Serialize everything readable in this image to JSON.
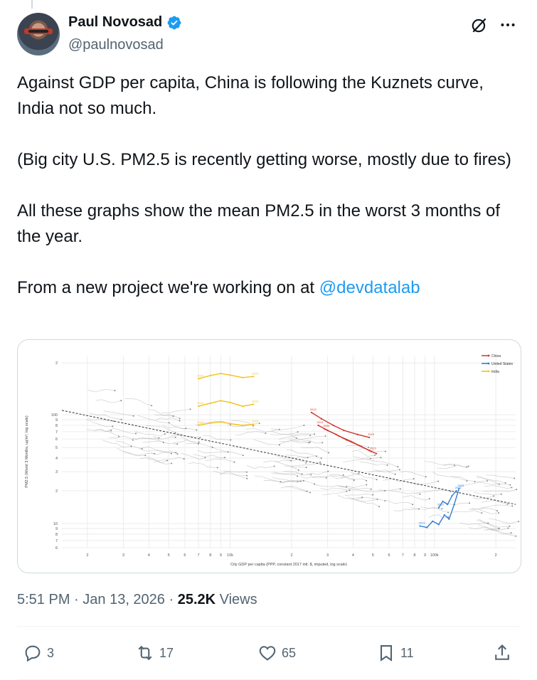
{
  "author": {
    "name": "Paul Novosad",
    "handle": "@paulnovosad"
  },
  "tweet": {
    "para1": "Against GDP per capita, China is following the Kuznets curve, India not so much.",
    "para2": "(Big city U.S. PM2.5 is recently getting worse, mostly due to fires)",
    "para3": "All these graphs show the mean PM2.5 in the worst 3 months of the year.",
    "para4_prefix": "From a new project we're working on at ",
    "mention": "@devdatalab"
  },
  "meta": {
    "time": "5:51 PM",
    "sep": " · ",
    "date": "Jan 13, 2026",
    "views_count": "25.2K",
    "views_label": " Views"
  },
  "actions": {
    "replies": "3",
    "reposts": "17",
    "likes": "65",
    "bookmarks": "11"
  },
  "chart_data": {
    "type": "line",
    "title": "",
    "xlabel": "City GDP per capita (PPP, constant 2017 intl. $, imputed, log scale)",
    "ylabel": "PM2.5 (Worst 3 Months, ug/m³, log scale)",
    "x_scale": "log",
    "y_scale": "log",
    "xlim": [
      1500,
      250000
    ],
    "ylim": [
      6,
      350
    ],
    "x_tick_labels": [
      "2",
      "3",
      "4",
      "5",
      "6",
      "7",
      "8",
      "9",
      "10k",
      "2",
      "3",
      "4",
      "5",
      "6",
      "7",
      "8",
      "9",
      "100k",
      "2"
    ],
    "y_tick_labels": [
      "2",
      "100",
      "9",
      "8",
      "7",
      "6",
      "5",
      "4",
      "3",
      "2",
      "10",
      "9",
      "8",
      "7",
      "6"
    ],
    "legend_position": "top-right",
    "legend": [
      "China",
      "United States",
      "India"
    ],
    "colors": {
      "China": "#d0352c",
      "United States": "#2f7ed8",
      "India": "#f2c21b",
      "other": "#9a9a9a",
      "trend": "#333333"
    },
    "series": [
      {
        "name": "China",
        "lines": [
          {
            "x": [
              25000,
              28000,
              32000,
              36000,
              42000,
              48000
            ],
            "y": [
              105,
              92,
              80,
              72,
              66,
              62
            ]
          },
          {
            "x": [
              27000,
              30000,
              34000,
              39000,
              44000,
              49000
            ],
            "y": [
              80,
              72,
              64,
              57,
              51,
              46
            ]
          },
          {
            "x": [
              29000,
              33000,
              37000,
              43000,
              48000,
              52000
            ],
            "y": [
              74,
              66,
              59,
              52,
              47,
              44
            ]
          }
        ],
        "labels": [
          "2013",
          "2023",
          "2013",
          "2023",
          "2023"
        ]
      },
      {
        "name": "United States",
        "lines": [
          {
            "x": [
              85000,
              92000,
              98000,
              105000,
              112000,
              118000,
              125000,
              132000
            ],
            "y": [
              9.5,
              9.2,
              10.5,
              9.8,
              12,
              11,
              15,
              21
            ]
          },
          {
            "x": [
              105000,
              110000,
              116000,
              122000,
              128000
            ],
            "y": [
              14,
              16,
              15,
              18,
              20
            ]
          }
        ],
        "labels": [
          "2013",
          "2023",
          "2023",
          "2023"
        ]
      },
      {
        "name": "India",
        "lines": [
          {
            "x": [
              7000,
              8000,
              9000,
              10000,
              11500,
              13000
            ],
            "y": [
              215,
              230,
              240,
              232,
              220,
              225
            ]
          },
          {
            "x": [
              7000,
              8000,
              9000,
              10000,
              11500,
              13000
            ],
            "y": [
              120,
              128,
              135,
              130,
              120,
              125
            ]
          },
          {
            "x": [
              7000,
              8000,
              9000,
              10000,
              11500,
              13000
            ],
            "y": [
              80,
              84,
              86,
              83,
              80,
              82
            ]
          }
        ],
        "labels": [
          "2013",
          "2023",
          "2013",
          "2023",
          "2013",
          "2023"
        ]
      }
    ],
    "trend_line": {
      "x": [
        1500,
        250000
      ],
      "y": [
        110,
        15
      ]
    }
  }
}
